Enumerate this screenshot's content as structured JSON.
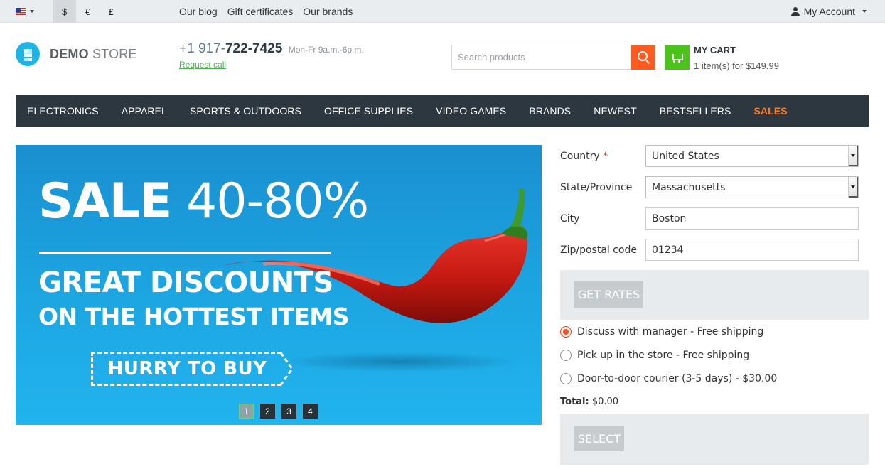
{
  "topbar": {
    "language_icon": "us-flag-icon",
    "currencies": [
      {
        "symbol": "$",
        "active": true
      },
      {
        "symbol": "€",
        "active": false
      },
      {
        "symbol": "£",
        "active": false
      }
    ],
    "links": [
      "Our blog",
      "Gift certificates",
      "Our brands"
    ],
    "account_label": "My Account"
  },
  "header": {
    "logo_bold": "DEMO",
    "logo_light": "STORE",
    "phone_prefix": "+1 917-",
    "phone_main": "722-7425",
    "hours": "Mon-Fr 9a.m.-6p.m.",
    "request_call": "Request call",
    "search_placeholder": "Search products",
    "cart_title": "MY CART",
    "cart_summary": "1 item(s) for $149.99"
  },
  "nav": {
    "items": [
      "ELECTRONICS",
      "APPAREL",
      "SPORTS & OUTDOORS",
      "OFFICE SUPPLIES",
      "VIDEO GAMES",
      "BRANDS",
      "NEWEST",
      "BESTSELLERS",
      "SALES"
    ],
    "highlight_color": "#ff7a1f"
  },
  "banner": {
    "sale_word": "SALE",
    "sale_range": "40-80%",
    "headline": "GREAT DISCOUNTS",
    "subheadline": "ON THE HOTTEST ITEMS",
    "cta": "HURRY TO BUY",
    "pages": [
      "1",
      "2",
      "3",
      "4"
    ],
    "active_page": "1"
  },
  "shipping": {
    "country_label": "Country",
    "required_mark": "*",
    "country_value": "United States",
    "state_label": "State/Province",
    "state_value": "Massachusetts",
    "city_label": "City",
    "city_value": "Boston",
    "zip_label": "Zip/postal code",
    "zip_value": "01234",
    "get_rates_label": "GET RATES",
    "options": [
      {
        "label": "Discuss with manager - Free shipping",
        "selected": true
      },
      {
        "label": "Pick up in the store - Free shipping",
        "selected": false
      },
      {
        "label": "Door-to-door courier (3-5 days) - $30.00",
        "selected": false
      }
    ],
    "total_label": "Total:",
    "total_value": "$0.00",
    "select_label": "SELECT"
  }
}
